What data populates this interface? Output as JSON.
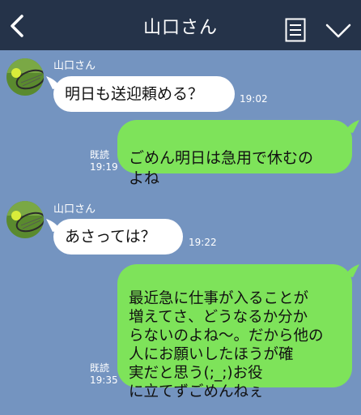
{
  "header": {
    "title": "山口さん",
    "back_icon": "chevron-left-icon",
    "menu_icon": "document-list-icon",
    "collapse_icon": "chevron-down-icon"
  },
  "colors": {
    "header_bg": "#253349",
    "chat_bg": "#7494c0",
    "outgoing_bubble": "#7ee35a",
    "incoming_bubble": "#ffffff"
  },
  "messages": [
    {
      "direction": "incoming",
      "sender": "山口さん",
      "text": "明日も送迎頼める？",
      "time": "19:02"
    },
    {
      "direction": "outgoing",
      "text": "ごめん明日は急用で休むの\nよね",
      "read": "既読",
      "time": "19:19"
    },
    {
      "direction": "incoming",
      "sender": "山口さん",
      "text": "あさっては？",
      "time": "19:22"
    },
    {
      "direction": "outgoing",
      "text": "最近急に仕事が入ることが\n増えてさ、どうなるか分か\nらないのよね〜。だから他の\n人にお願いしたほうが確\n実だと思う(;_;)お役\nに立てずごめんねぇ",
      "read": "既読",
      "time": "19:35"
    }
  ]
}
